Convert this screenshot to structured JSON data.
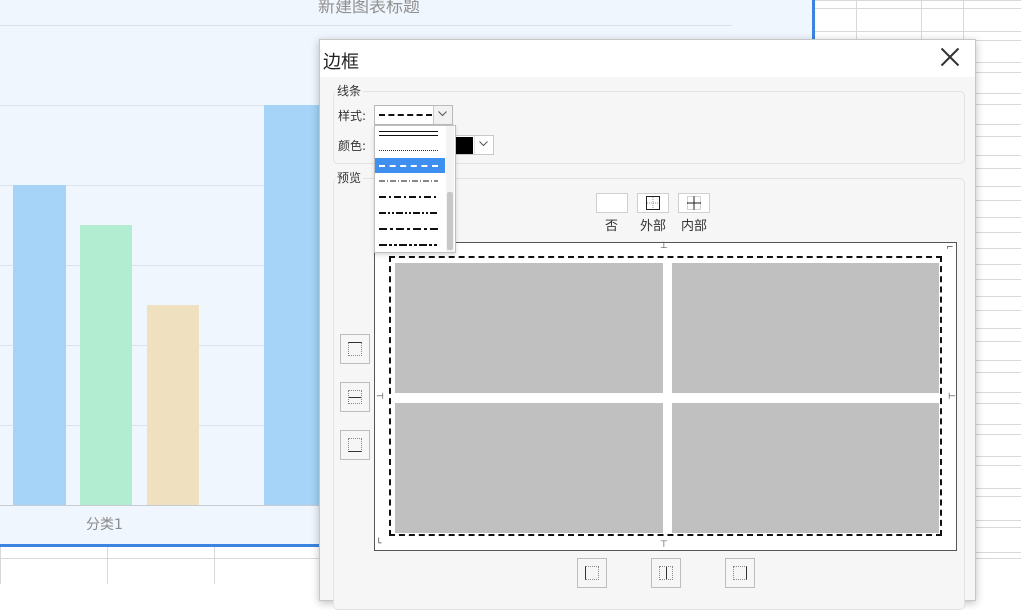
{
  "chart": {
    "title": "新建图表标题",
    "category_label": "分类1",
    "bar_colors": [
      "#a5d4f8",
      "#b2ecd1",
      "#efe0c0",
      "#a5d4f8"
    ]
  },
  "dialog": {
    "title": "边框",
    "line_group_label": "线条",
    "style_label": "样式:",
    "color_label": "颜色:",
    "preview_group_label": "预览",
    "presets": [
      {
        "label": "否",
        "icon": "no-border-icon"
      },
      {
        "label": "外部",
        "icon": "outer-border-icon"
      },
      {
        "label": "内部",
        "icon": "inner-border-icon"
      }
    ],
    "selected_color": "#000000",
    "line_styles": [
      {
        "name": "double",
        "selected": false
      },
      {
        "name": "dotted",
        "selected": false
      },
      {
        "name": "dashed",
        "selected": true
      },
      {
        "name": "dash-dot-fine",
        "selected": false
      },
      {
        "name": "dash-dot",
        "selected": false
      },
      {
        "name": "dash-dot-dot",
        "selected": false
      },
      {
        "name": "dash-dot-thick",
        "selected": false
      },
      {
        "name": "dash-dot-dot-thick",
        "selected": false
      }
    ]
  }
}
